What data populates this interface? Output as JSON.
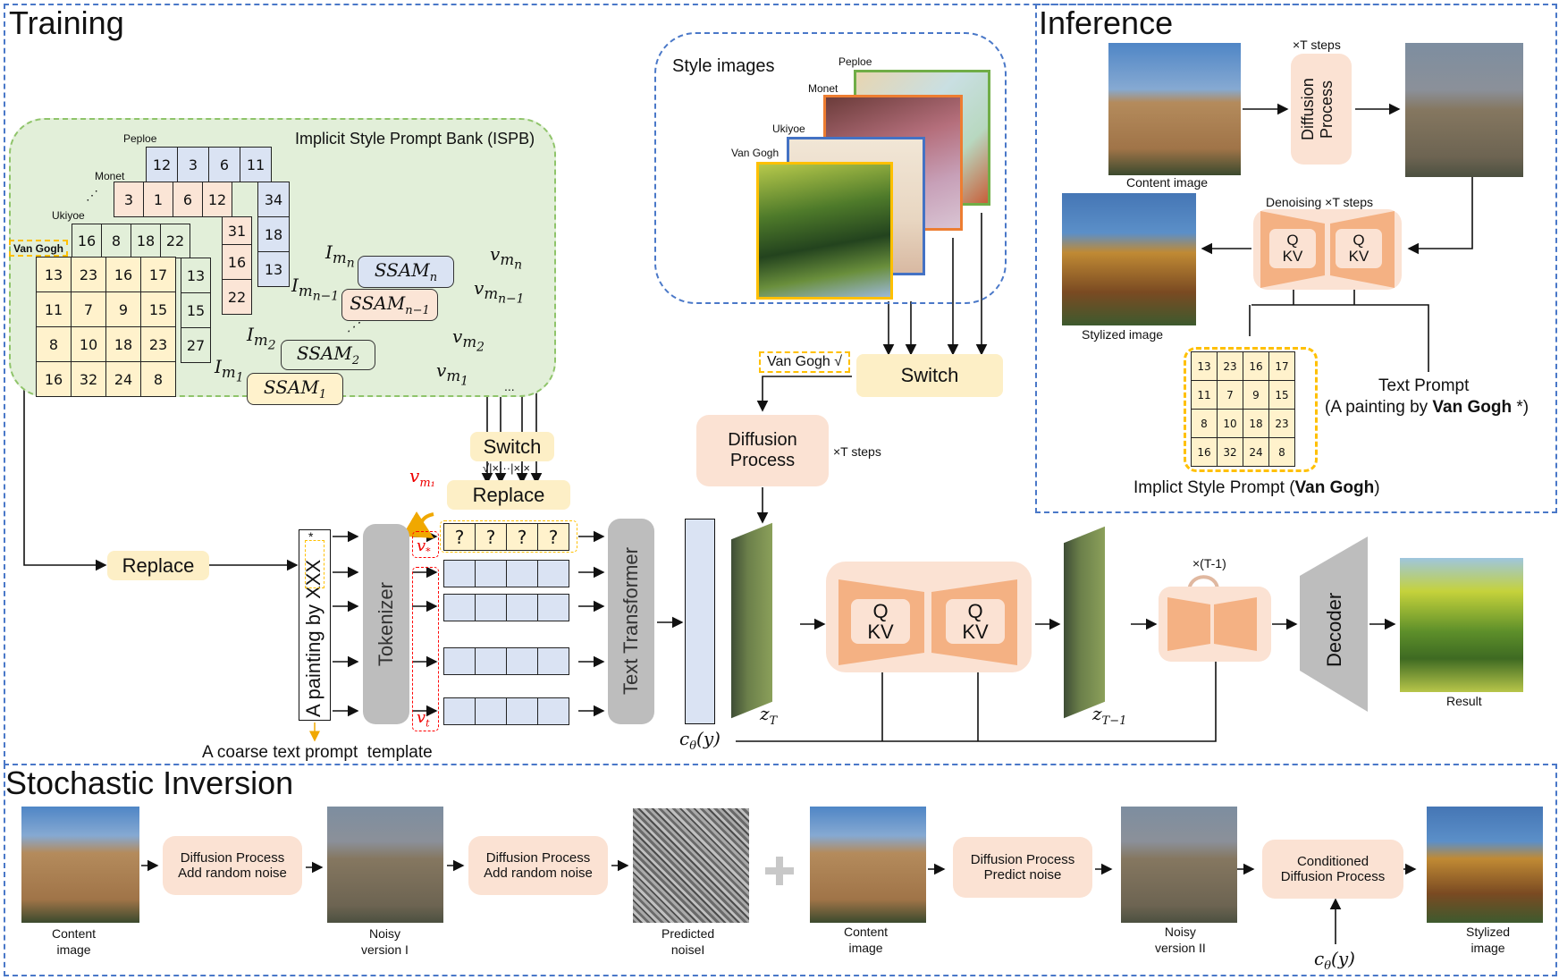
{
  "training": {
    "title": "Training",
    "ispb": {
      "title": "Implicit Style Prompt Bank (ISPB)",
      "style_labels": {
        "peploe": "Peploe",
        "monet": "Monet",
        "ukiyoe": "Ukiyoe",
        "van_gogh": "Van Gogh",
        "ellipsis": "⋰"
      },
      "peploe_row": [
        "12",
        "3",
        "6",
        "11"
      ],
      "peploe_col": [
        "34",
        "18",
        "13"
      ],
      "monet_row": [
        "3",
        "1",
        "6",
        "12"
      ],
      "monet_col": [
        "31",
        "16",
        "22"
      ],
      "ukiyoe_row": [
        "16",
        "8",
        "18",
        "22"
      ],
      "ukiyoe_col": [
        "13",
        "15",
        "27"
      ],
      "van_gogh_grid": [
        [
          "13",
          "23",
          "16",
          "17"
        ],
        [
          "11",
          "7",
          "9",
          "15"
        ],
        [
          "8",
          "10",
          "18",
          "23"
        ],
        [
          "16",
          "32",
          "24",
          "8"
        ]
      ],
      "ssam": [
        {
          "name": "SSAM",
          "sub": "n",
          "input": "I",
          "input_sub": "m",
          "input_subsub": "n",
          "output": "v",
          "output_sub": "m",
          "output_subsub": "n"
        },
        {
          "name": "SSAM",
          "sub": "n−1",
          "input": "I",
          "input_sub": "m",
          "input_subsub": "n−1",
          "output": "v",
          "output_sub": "m",
          "output_subsub": "n−1"
        },
        {
          "name": "SSAM",
          "sub": "2",
          "input": "I",
          "input_sub": "m",
          "input_subsub": "2",
          "output": "v",
          "output_sub": "m",
          "output_subsub": "2"
        },
        {
          "name": "SSAM",
          "sub": "1",
          "input": "I",
          "input_sub": "m",
          "input_subsub": "1",
          "output": "v",
          "output_sub": "m",
          "output_subsub": "1"
        }
      ],
      "ellipsis_dots": "⋰",
      "ellipsis_h": "..."
    },
    "switch_label": "Switch",
    "switch_marks": "√|×···|×|×",
    "replace_label": "Replace",
    "replace_left_label": "Replace",
    "v_m1": "v",
    "v_m1_sub": "m₁",
    "prompt_template": "A painting by XXX",
    "prompt_star": "*",
    "prompt_caption": "A coarse text prompt  template",
    "tokenizer_label": "Tokenizer",
    "v_star": "v",
    "v_star_sub": "*",
    "v_t": "v",
    "v_t_sub": "t",
    "placeholder_tokens": [
      "?",
      "?",
      "?",
      "?"
    ],
    "text_transformer_label": "Text Transformer",
    "c_theta": "c",
    "c_theta_sub": "θ",
    "c_theta_arg": "(y)",
    "style_images": {
      "title": "Style images",
      "labels": [
        "Peploe",
        "Monet",
        "Ukiyoe",
        "Van Gogh"
      ],
      "colors": {
        "peploe": "#70ad47",
        "monet": "#ed7d31",
        "ukiyoe": "#4472c4",
        "van_gogh": "#ffc000"
      }
    },
    "selected_style": "Van Gogh √",
    "switch2_label": "Switch",
    "diffusion_label_1": "Diffusion",
    "diffusion_label_2": "Process",
    "t_steps": "×T steps",
    "z_T": "z",
    "z_T_sub": "T",
    "z_T1": "z",
    "z_T1_sub": "T−1",
    "unet_q": "Q",
    "unet_kv": "KV",
    "loop_label": "×(T-1)",
    "decoder_label": "Decoder",
    "result_label": "Result"
  },
  "inference": {
    "title": "Inference",
    "t_steps": "×T steps",
    "diffusion_label": "Diffusion Process",
    "content_label": "Content image",
    "denoising_label": "Denoising ×T steps",
    "unet_q": "Q",
    "unet_kv": "KV",
    "stylized_label": "Stylized image",
    "grid": [
      [
        "13",
        "23",
        "16",
        "17"
      ],
      [
        "11",
        "7",
        "9",
        "15"
      ],
      [
        "8",
        "10",
        "18",
        "23"
      ],
      [
        "16",
        "32",
        "24",
        "8"
      ]
    ],
    "text_prompt_title": "Text Prompt",
    "text_prompt_prefix": "(A painting by ",
    "text_prompt_bold": "Van Gogh",
    "text_prompt_suffix": " *)",
    "isp_caption_prefix": "Implict Style Prompt (",
    "isp_caption_bold": "Van Gogh",
    "isp_caption_suffix": ")"
  },
  "stochastic_inversion": {
    "title": "Stochastic Inversion",
    "steps": [
      {
        "type": "image",
        "label_1": "Content",
        "label_2": "image"
      },
      {
        "type": "box",
        "label_1": "Diffusion Process",
        "label_2": "Add random noise"
      },
      {
        "type": "image",
        "label_1": "Noisy",
        "label_2": "version I"
      },
      {
        "type": "box",
        "label_1": "Diffusion Process",
        "label_2": "Add random noise"
      },
      {
        "type": "image",
        "label_1": "Predicted",
        "label_2": "noiseI"
      },
      {
        "type": "plus",
        "label_1": "+"
      },
      {
        "type": "image",
        "label_1": "Content",
        "label_2": "image"
      },
      {
        "type": "box",
        "label_1": "Diffusion Process",
        "label_2": "Predict noise"
      },
      {
        "type": "image",
        "label_1": "Noisy",
        "label_2": "version II"
      },
      {
        "type": "box",
        "label_1": "Conditioned",
        "label_2": "Diffusion Process"
      },
      {
        "type": "image",
        "label_1": "Stylized",
        "label_2": "image"
      }
    ],
    "condition": "c",
    "condition_sub": "θ",
    "condition_arg": "(y)"
  },
  "colors": {
    "panel_border": "#4a78c8",
    "ispb_bg": "#e2efd9",
    "ispb_border": "#8fc46a",
    "yellow_box": "#fdefc6",
    "peach_box": "#fbe2d3",
    "unet_orange": "#f4b183",
    "gray_box": "#bdbdbd",
    "blue_cell": "#dae3f3",
    "pink_cell": "#fbe5d6",
    "yellow_cell": "#fff2cc",
    "green_cell": "#e2efd9",
    "dash_yellow": "#ffc000",
    "dash_red": "#ff0000"
  }
}
